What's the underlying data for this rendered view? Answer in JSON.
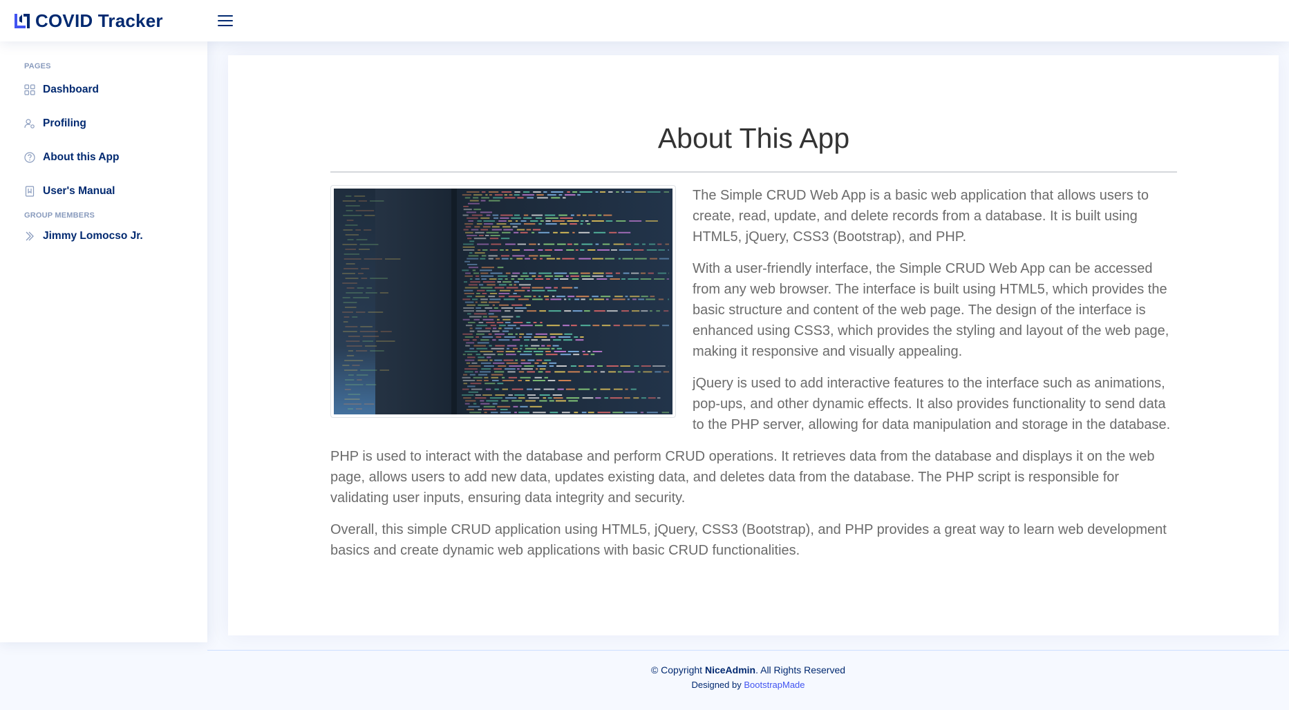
{
  "app": {
    "logo_text": "COVID Tracker"
  },
  "sidebar": {
    "heading_pages": "PAGES",
    "items": [
      {
        "label": "Dashboard",
        "icon": "grid-icon"
      },
      {
        "label": "Profiling",
        "icon": "person-gear-icon"
      },
      {
        "label": "About this App",
        "icon": "question-circle-icon"
      },
      {
        "label": "User's Manual",
        "icon": "bookmark-icon"
      }
    ],
    "heading_group": "GROUP MEMBERS",
    "members": [
      {
        "label": "Jimmy Lomocso Jr.",
        "icon": "chevron-double-right-icon"
      }
    ]
  },
  "main": {
    "title": "About This App",
    "paragraphs": [
      "The Simple CRUD Web App is a basic web application that allows users to create, read, update, and delete records from a database. It is built using HTML5, jQuery, CSS3 (Bootstrap), and PHP.",
      "With a user-friendly interface, the Simple CRUD Web App can be accessed from any web browser. The interface is built using HTML5, which provides the basic structure and content of the web page. The design of the interface is enhanced using CSS3, which provides the styling and layout of the web page, making it responsive and visually appealing.",
      "jQuery is used to add interactive features to the interface such as animations, pop-ups, and other dynamic effects. It also provides functionality to send data to the PHP server, allowing for data manipulation and storage in the database.",
      "PHP is used to interact with the database and perform CRUD operations. It retrieves data from the database and displays it on the web page, allows users to add new data, updates existing data, and deletes data from the database. The PHP script is responsible for validating user inputs, ensuring data integrity and security.",
      "Overall, this simple CRUD application using HTML5, jQuery, CSS3 (Bootstrap), and PHP provides a great way to learn web development basics and create dynamic web applications with basic CRUD functionalities."
    ]
  },
  "footer": {
    "copyright_prefix": "© Copyright ",
    "brand": "NiceAdmin",
    "copyright_suffix": ". All Rights Reserved",
    "designed_by": "Designed by ",
    "designer": "BootstrapMade"
  },
  "colors": {
    "brand": "#012970",
    "accent": "#4154f1",
    "background": "#f6f9ff",
    "muted": "#899bbd"
  }
}
